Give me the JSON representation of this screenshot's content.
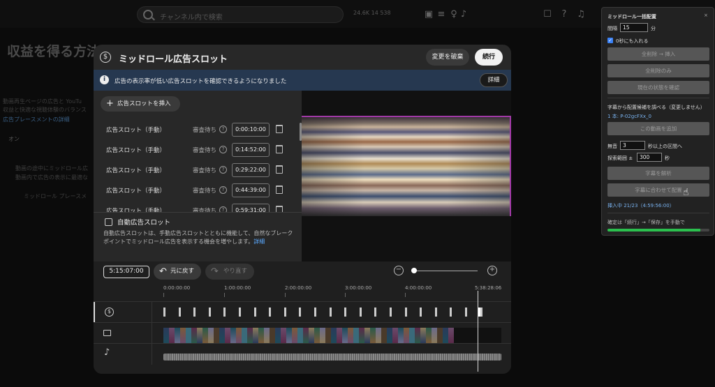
{
  "header": {
    "search_placeholder": "チャンネル内で検索",
    "stats": "24.6K  14  538"
  },
  "background": {
    "title": "収益を得る方法",
    "line1": "動画再生ページの広告と YouTu",
    "line2": "収益と快適な視聴体験のバランス",
    "link": "広告プレースメントの詳細",
    "on_label": "オン",
    "check_line": "動画の途中にミッドロール広",
    "check_sub": "動画内で広告の表示に最適な",
    "midroll_btn": "ミッドロール プレースメ"
  },
  "modal": {
    "title": "ミッドロール広告スロット",
    "discard_label": "変更を破棄",
    "continue_label": "続行",
    "banner_text": "広告の表示率が低い広告スロットを確認できるようになりました",
    "banner_detail": "詳細",
    "insert_label": "広告スロットを挿入",
    "slots": [
      {
        "label": "広告スロット（手動）",
        "status": "審査待ち",
        "time": "0:00:10:00"
      },
      {
        "label": "広告スロット（手動）",
        "status": "審査待ち",
        "time": "0:14:52:00"
      },
      {
        "label": "広告スロット（手動）",
        "status": "審査待ち",
        "time": "0:29:22:00"
      },
      {
        "label": "広告スロット（手動）",
        "status": "審査待ち",
        "time": "0:44:39:00"
      },
      {
        "label": "広告スロット（手動）",
        "status": "審査待ち",
        "time": "0:59:31:00"
      }
    ],
    "auto_title": "自動広告スロット",
    "auto_desc": "自動広告スロットは、手動広告スロットとともに機能して、自然なブレークポイントでミッドロール広告を表示する機会を増やします。",
    "auto_link": "詳細",
    "timecode": "5:15:07:00",
    "undo_label": "元に戻す",
    "redo_label": "やり直す",
    "ticks": [
      "0:00:00:00",
      "1:00:00:00",
      "2:00:00:00",
      "3:00:00:00",
      "4:00:00:00",
      "5:38:28:06"
    ]
  },
  "panel": {
    "title": "ミッドロール一括配置",
    "close": "×",
    "interval_label": "間隔",
    "interval_value": "15",
    "interval_unit": "分",
    "zero_label": "0秒にも入れる",
    "btn_delete_insert": "全削除 → 挿入",
    "btn_delete_all": "全削除のみ",
    "btn_check_state": "現在の状態を確認",
    "subtitle_note": "字幕から配置候補を調べる（変更しません）",
    "video_id": "1 本: P-02gcFXx_0",
    "btn_add_video": "この動画を追加",
    "silence_label": "無音",
    "silence_value": "3",
    "silence_unit": "秒以上の区間へ",
    "range_label": "探索範囲 ±",
    "range_value": "300",
    "range_unit": "秒",
    "btn_analyze": "字幕を解析",
    "btn_place": "字幕に合わせて配置",
    "status": "挿入中 21/23（4:59:56:00）",
    "footer_note": "確定は「続行」→「保存」を手動で",
    "progress": 0.91
  }
}
